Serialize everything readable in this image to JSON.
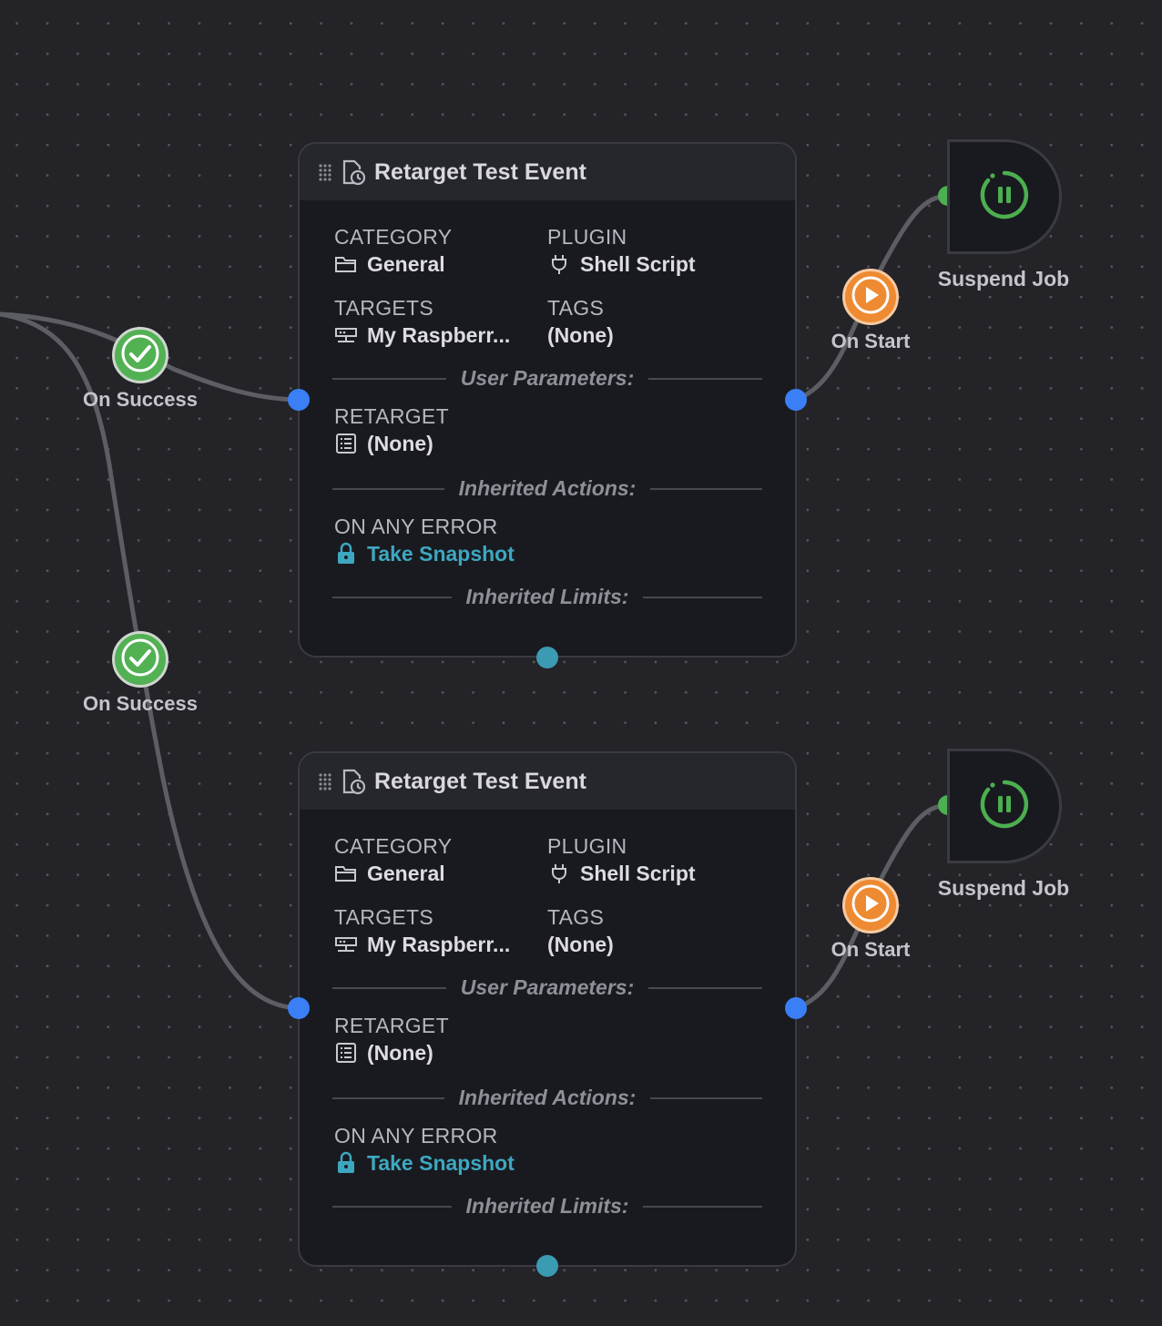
{
  "colors": {
    "canvas_bg": "#232328",
    "node_bg": "#191a1f",
    "port_blue": "#3a7ff6",
    "success_green": "#52b153",
    "start_orange": "#ee8a31",
    "link_teal": "#3ea7c0",
    "suspend_green": "#4caf50"
  },
  "nodes": [
    {
      "title": "Retarget Test Event",
      "icon": "event-clock-icon",
      "category_label": "CATEGORY",
      "category_value": "General",
      "plugin_label": "PLUGIN",
      "plugin_value": "Shell Script",
      "targets_label": "TARGETS",
      "targets_value": "My Raspberr...",
      "tags_label": "TAGS",
      "tags_value": "(None)",
      "user_params_heading": "User Parameters:",
      "retarget_label": "RETARGET",
      "retarget_value": "(None)",
      "inherited_actions_heading": "Inherited Actions:",
      "on_any_error_label": "ON ANY ERROR",
      "on_any_error_value": "Take Snapshot",
      "inherited_limits_heading": "Inherited Limits:"
    },
    {
      "title": "Retarget Test Event",
      "icon": "event-clock-icon",
      "category_label": "CATEGORY",
      "category_value": "General",
      "plugin_label": "PLUGIN",
      "plugin_value": "Shell Script",
      "targets_label": "TARGETS",
      "targets_value": "My Raspberr...",
      "tags_label": "TAGS",
      "tags_value": "(None)",
      "user_params_heading": "User Parameters:",
      "retarget_label": "RETARGET",
      "retarget_value": "(None)",
      "inherited_actions_heading": "Inherited Actions:",
      "on_any_error_label": "ON ANY ERROR",
      "on_any_error_value": "Take Snapshot",
      "inherited_limits_heading": "Inherited Limits:"
    }
  ],
  "condition_badges": [
    {
      "label": "On Success",
      "icon": "check-circle-icon"
    },
    {
      "label": "On Success",
      "icon": "check-circle-icon"
    },
    {
      "label": "On Start",
      "icon": "play-icon"
    },
    {
      "label": "On Start",
      "icon": "play-icon"
    }
  ],
  "action_nodes": [
    {
      "label": "Suspend Job",
      "icon": "suspend-pause-icon"
    },
    {
      "label": "Suspend Job",
      "icon": "suspend-pause-icon"
    }
  ]
}
